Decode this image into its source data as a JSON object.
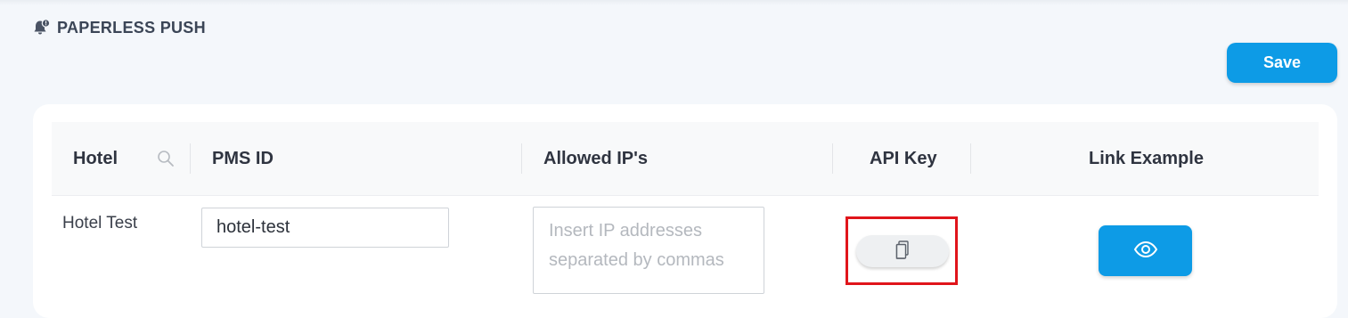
{
  "header": {
    "title": "PAPERLESS PUSH",
    "icon": "bell-icon"
  },
  "toolbar": {
    "save_label": "Save"
  },
  "table": {
    "columns": [
      "Hotel",
      "PMS ID",
      "Allowed IP's",
      "API Key",
      "Link Example"
    ],
    "rows": [
      {
        "hotel": "Hotel Test",
        "pms_id": "hotel-test",
        "allowed_ips": "",
        "allowed_ips_placeholder": "Insert IP addresses separated by commas",
        "api_key_icon": "copy-icon",
        "link_icon": "eye-icon"
      }
    ]
  },
  "colors": {
    "primary": "#0d9be6",
    "highlight": "#e0151b",
    "background": "#f4f7fb"
  }
}
